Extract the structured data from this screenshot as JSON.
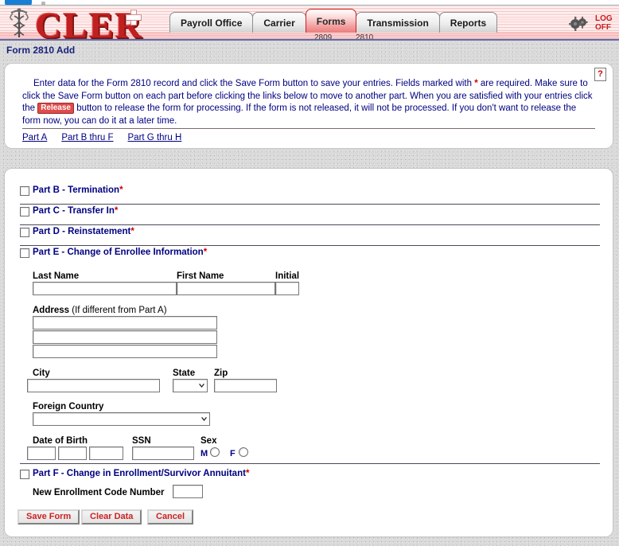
{
  "browser": {
    "tab_stub": ""
  },
  "header": {
    "brand": "CLER",
    "logo_icon": "caduceus-icon",
    "gears_icon": "gears-icon",
    "logoff_line1": "LOG",
    "logoff_line2": "OFF",
    "tabs": [
      {
        "label": "Payroll Office",
        "active": false
      },
      {
        "label": "Carrier",
        "active": false
      },
      {
        "label": "Forms",
        "active": true
      },
      {
        "label": "Transmission",
        "active": false
      },
      {
        "label": "Reports",
        "active": false
      }
    ],
    "subtabs": {
      "form_2809": "2809",
      "form_2810": "2810"
    }
  },
  "page": {
    "title": "Form 2810 Add"
  },
  "instructions": {
    "help_icon_label": "?",
    "text_part1": "Enter data for the Form 2810 record and click the Save Form button to save your entries.  Fields marked with ",
    "required_star": "*",
    "text_part2": " are required.  Make sure to click the Save Form button on each part before clicking the links below to move to another part.  When you are satisfied with your entries click the ",
    "release_chip": "Release",
    "text_part3": " button to release the form for processing.  If the form is not released, it will not be processed.  If you don't want to release the form now, you can do it at a later time.",
    "links": [
      {
        "label": "Part A"
      },
      {
        "label": "Part B thru F"
      },
      {
        "label": "Part G thru H"
      }
    ]
  },
  "form": {
    "sections": [
      {
        "label": "Part B - Termination",
        "required": "*",
        "checked": false
      },
      {
        "label": "Part C - Transfer In",
        "required": "*",
        "checked": false
      },
      {
        "label": "Part D - Reinstatement",
        "required": "*",
        "checked": false
      },
      {
        "label": "Part E - Change of Enrollee Information",
        "required": "*",
        "checked": false
      }
    ],
    "part_f": {
      "label": "Part F - Change in Enrollment/Survivor Annuitant",
      "required": "*",
      "checked": false
    },
    "fields": {
      "last_name_label": "Last Name",
      "last_name_value": "",
      "first_name_label": "First Name",
      "first_name_value": "",
      "initial_label": "Initial",
      "initial_value": "",
      "address_label": "Address",
      "address_note": "(If different from Part A)",
      "address_line1": "",
      "address_line2": "",
      "address_line3": "",
      "city_label": "City",
      "city_value": "",
      "state_label": "State",
      "state_value": "",
      "zip_label": "Zip",
      "zip_value": "",
      "foreign_country_label": "Foreign Country",
      "foreign_country_value": "",
      "dob_label": "Date of Birth",
      "dob_month": "",
      "dob_day": "",
      "dob_year": "",
      "ssn_label": "SSN",
      "ssn_value": "",
      "sex_label": "Sex",
      "sex_male": "M",
      "sex_female": "F",
      "enrollment_code_label": "New Enrollment Code Number",
      "enrollment_code_value": ""
    },
    "buttons": [
      {
        "label": "Save Form"
      },
      {
        "label": "Clear Data"
      },
      {
        "label": "Cancel"
      }
    ]
  },
  "colors": {
    "brand_red": "#c02020",
    "nav_label": "#000080",
    "required": "#cc0000",
    "title_navy": "#1a237e",
    "button_text": "#cc2222"
  }
}
